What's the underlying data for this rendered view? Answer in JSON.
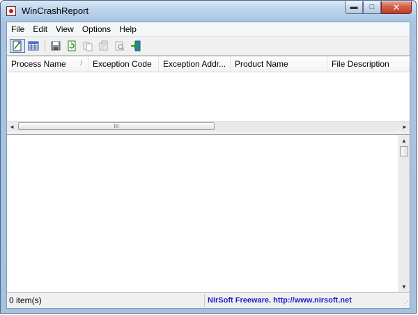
{
  "window": {
    "title": "WinCrashReport"
  },
  "caption": {
    "minimize": "▬",
    "maximize": "□",
    "close": "✕"
  },
  "menu": {
    "items": [
      "File",
      "Edit",
      "View",
      "Options",
      "Help"
    ]
  },
  "toolbar": {
    "buttons": [
      "report-view-icon",
      "grid-view-icon",
      "save-icon",
      "refresh-icon",
      "copy-icon",
      "properties-icon",
      "find-icon",
      "exit-icon"
    ]
  },
  "list": {
    "columns": [
      "Process Name",
      "Exception Code",
      "Exception Addr...",
      "Product Name",
      "File Description"
    ],
    "sort_glyph": "/",
    "scroll_grip": "III",
    "left_arrow": "◄",
    "right_arrow": "►"
  },
  "lower": {
    "up_arrow": "▲",
    "down_arrow": "▼"
  },
  "status": {
    "count": "0 item(s)",
    "link": "NirSoft Freeware.  http://www.nirsoft.net",
    "grip": "⋰"
  },
  "colors": {
    "link": "#1a22c8",
    "accent": "#3c7fb1",
    "close": "#c0392b"
  }
}
